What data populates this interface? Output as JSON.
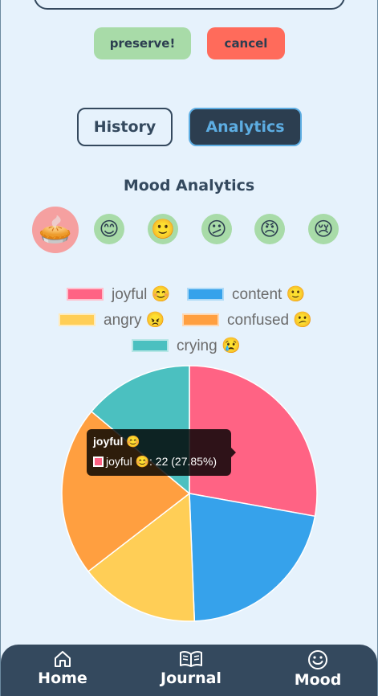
{
  "actions": {
    "preserve_label": "preserve!",
    "cancel_label": "cancel"
  },
  "tabs": [
    {
      "label": "History",
      "active": false
    },
    {
      "label": "Analytics",
      "active": true
    }
  ],
  "section_title": "Mood Analytics",
  "mood_filters": [
    {
      "emoji": "🥧",
      "selected": true
    },
    {
      "emoji": "😊",
      "selected": false
    },
    {
      "emoji": "🙂",
      "selected": false
    },
    {
      "emoji": "😕",
      "selected": false
    },
    {
      "emoji": "😠",
      "selected": false
    },
    {
      "emoji": "😢",
      "selected": false
    }
  ],
  "legend": [
    {
      "label": "joyful 😊",
      "color": "#ff6384"
    },
    {
      "label": "content 🙂",
      "color": "#36a2eb"
    },
    {
      "label": "angry 😠",
      "color": "#ffce56"
    },
    {
      "label": "confused 😕",
      "color": "#ff9f40"
    },
    {
      "label": "crying 😢",
      "color": "#4bc0c0"
    }
  ],
  "chart_data": {
    "type": "pie",
    "categories": [
      "joyful 😊",
      "content 🙂",
      "angry 😠",
      "confused 😕",
      "crying 😢"
    ],
    "values": [
      22,
      17,
      12,
      17,
      11
    ],
    "colors": [
      "#ff6384",
      "#36a2eb",
      "#ffce56",
      "#ff9f40",
      "#4bc0c0"
    ],
    "legend_position": "top"
  },
  "tooltip": {
    "title": "joyful 😊",
    "body": "joyful 😊: 22 (27.85%)"
  },
  "nav": [
    {
      "label": "Home",
      "icon": "home-icon"
    },
    {
      "label": "Journal",
      "icon": "book-icon"
    },
    {
      "label": "Mood",
      "icon": "smile-icon"
    }
  ]
}
